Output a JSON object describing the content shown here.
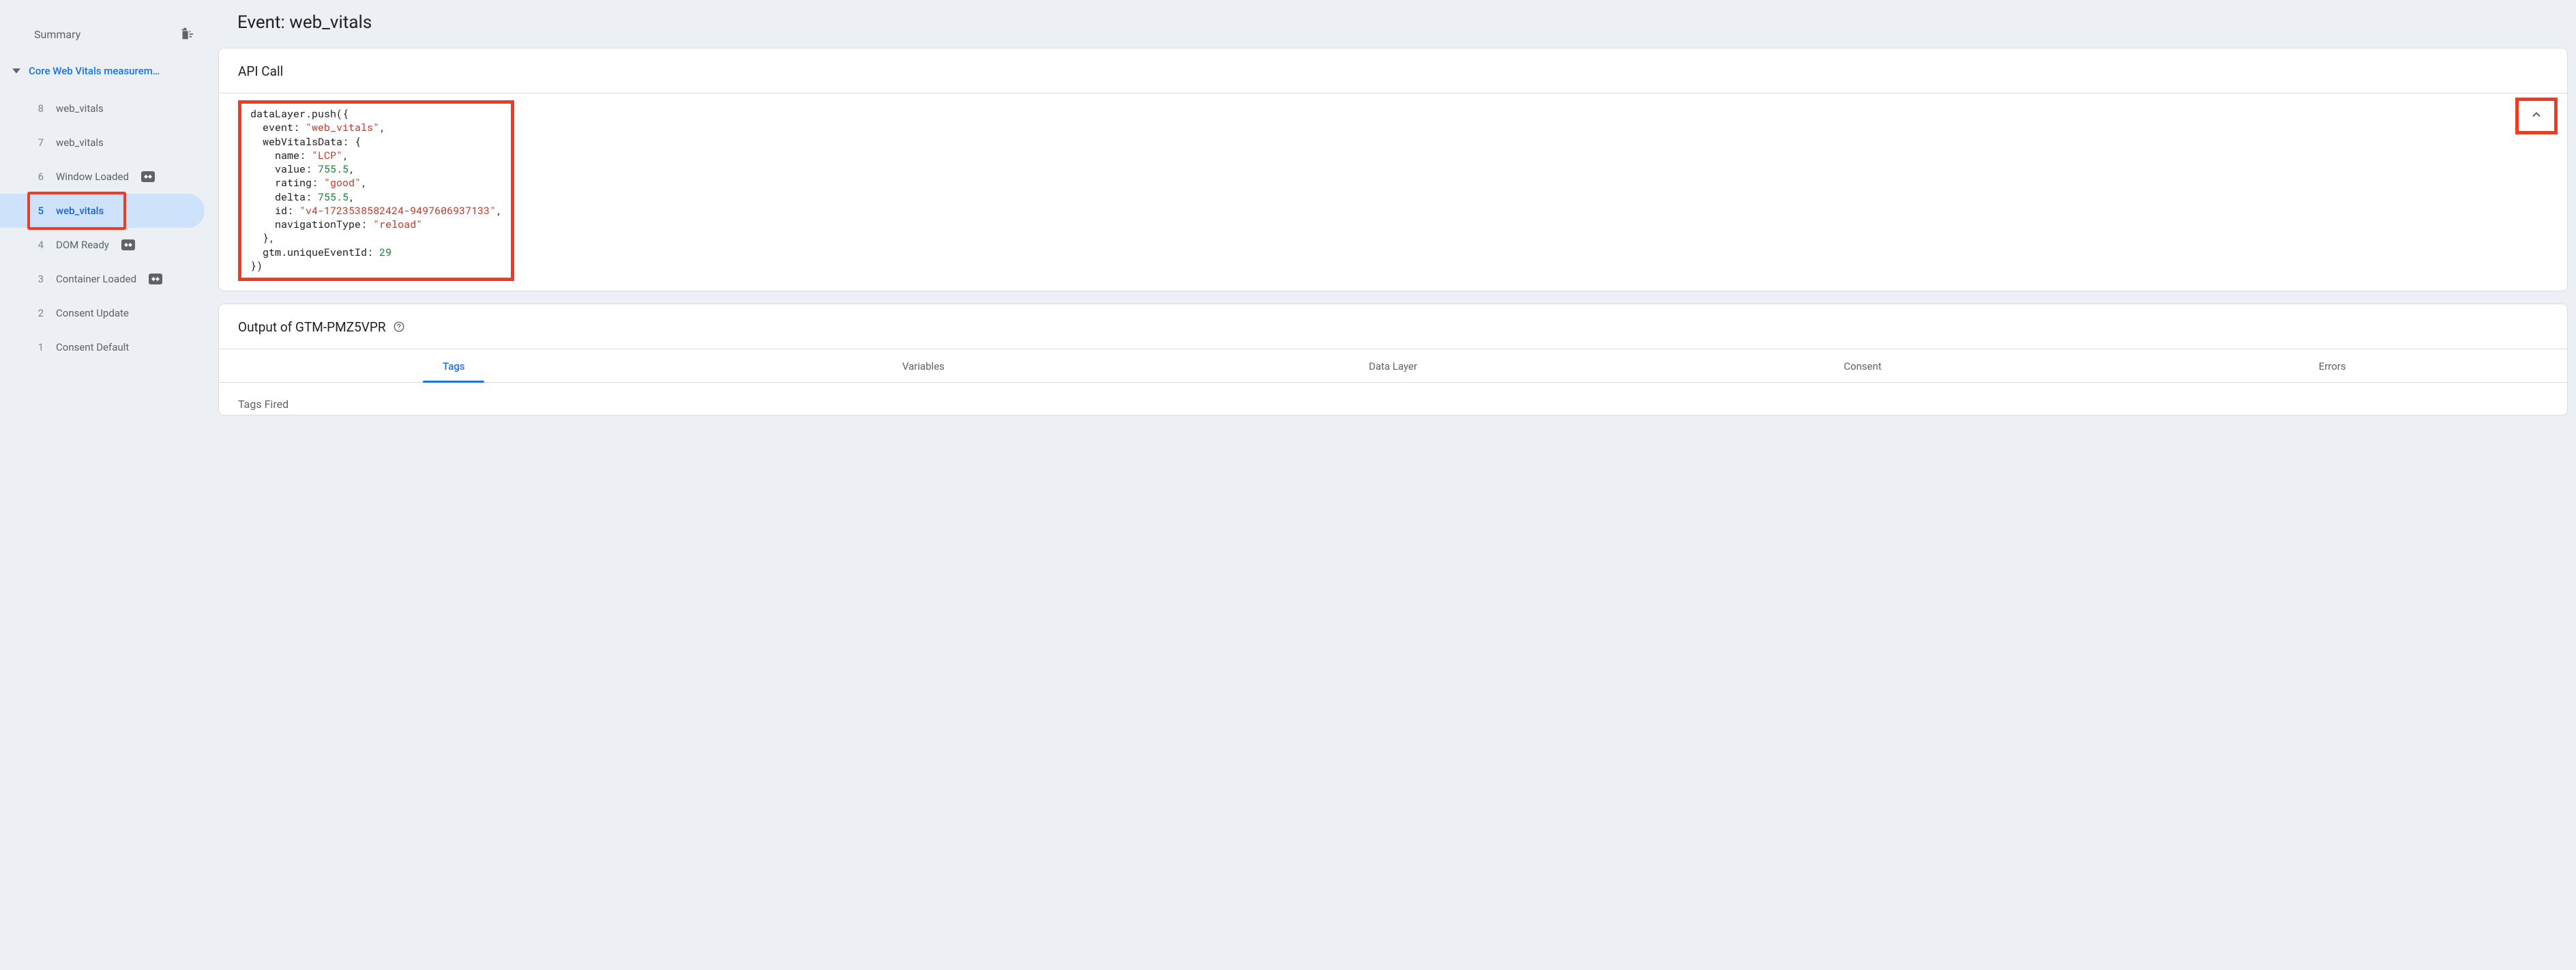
{
  "sidebar": {
    "summary_label": "Summary",
    "group_label": "Core Web Vitals measurem…",
    "events": [
      {
        "num": "8",
        "label": "web_vitals",
        "badge": false
      },
      {
        "num": "7",
        "label": "web_vitals",
        "badge": false
      },
      {
        "num": "6",
        "label": "Window Loaded",
        "badge": true
      },
      {
        "num": "5",
        "label": "web_vitals",
        "badge": false
      },
      {
        "num": "4",
        "label": "DOM Ready",
        "badge": true
      },
      {
        "num": "3",
        "label": "Container Loaded",
        "badge": true
      },
      {
        "num": "2",
        "label": "Consent Update",
        "badge": false
      },
      {
        "num": "1",
        "label": "Consent Default",
        "badge": false
      }
    ],
    "selected_index": 3
  },
  "main": {
    "title_prefix": "Event: ",
    "title_event": "web_vitals",
    "api_card_title": "API Call",
    "output_card_title_prefix": "Output of ",
    "container_id": "GTM-PMZ5VPR",
    "tabs": [
      "Tags",
      "Variables",
      "Data Layer",
      "Consent",
      "Errors"
    ],
    "active_tab": 0,
    "tags_fired_label": "Tags Fired",
    "code": {
      "fn": "dataLayer.push",
      "event": "web_vitals",
      "webVitalsData": {
        "name": "LCP",
        "value": 755.5,
        "rating": "good",
        "delta": 755.5,
        "id": "v4-1723538582424-9497606937133",
        "navigationType": "reload"
      },
      "uniqueEventId": 29
    }
  },
  "colors": {
    "accent": "#1a73e8",
    "highlight": "#ee3b24"
  }
}
